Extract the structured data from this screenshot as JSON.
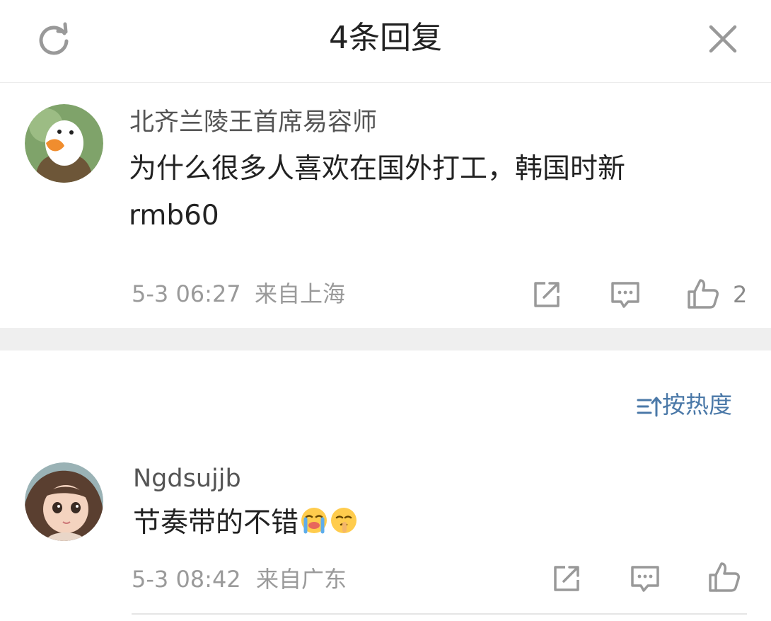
{
  "header": {
    "title": "4条回复"
  },
  "main_comment": {
    "username": "北齐兰陵王首席易容师",
    "text_line1": "为什么很多人喜欢在国外打工，韩国时新",
    "text_line2": "rmb60",
    "time": "5-3 06:27",
    "location": "来自上海",
    "likes": "2"
  },
  "sort": {
    "label": "按热度"
  },
  "replies": [
    {
      "username": "Ngdsujjb",
      "text": "节奏带的不错",
      "emojis": [
        "crying-face-emoji",
        "shushing-face-emoji"
      ],
      "time": "5-3 08:42",
      "location": "来自广东"
    }
  ]
}
